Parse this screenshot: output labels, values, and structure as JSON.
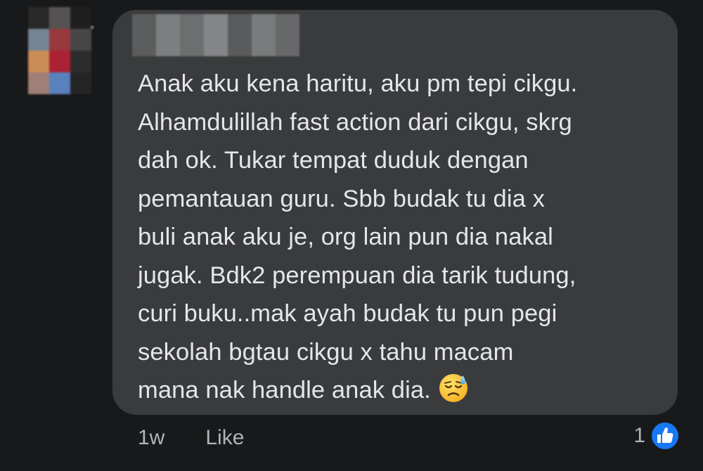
{
  "comment": {
    "lines": [
      "Anak aku kena haritu, aku pm tepi cikgu.",
      "Alhamdulillah fast action dari cikgu, skrg",
      "dah ok. Tukar tempat duduk dengan",
      "pemantauan guru. Sbb budak tu dia x",
      "buli anak aku je, org lain pun dia nakal",
      "jugak. Bdk2 perempuan dia tarik tudung,",
      "curi buku..mak ayah budak tu pun pegi",
      "sekolah bgtau cikgu x tahu macam",
      "mana nak handle anak dia."
    ],
    "emoji": "downcast-face-with-sweat",
    "timestamp": "1w",
    "like_label": "Like",
    "reaction_count": "1",
    "reaction_icon": "thumbs-up-icon"
  },
  "colors": {
    "background": "#18191a",
    "bubble": "#3a3b3c",
    "text": "#e4e6eb",
    "meta": "#b0b3b8",
    "like_blue": "#1877f2"
  }
}
